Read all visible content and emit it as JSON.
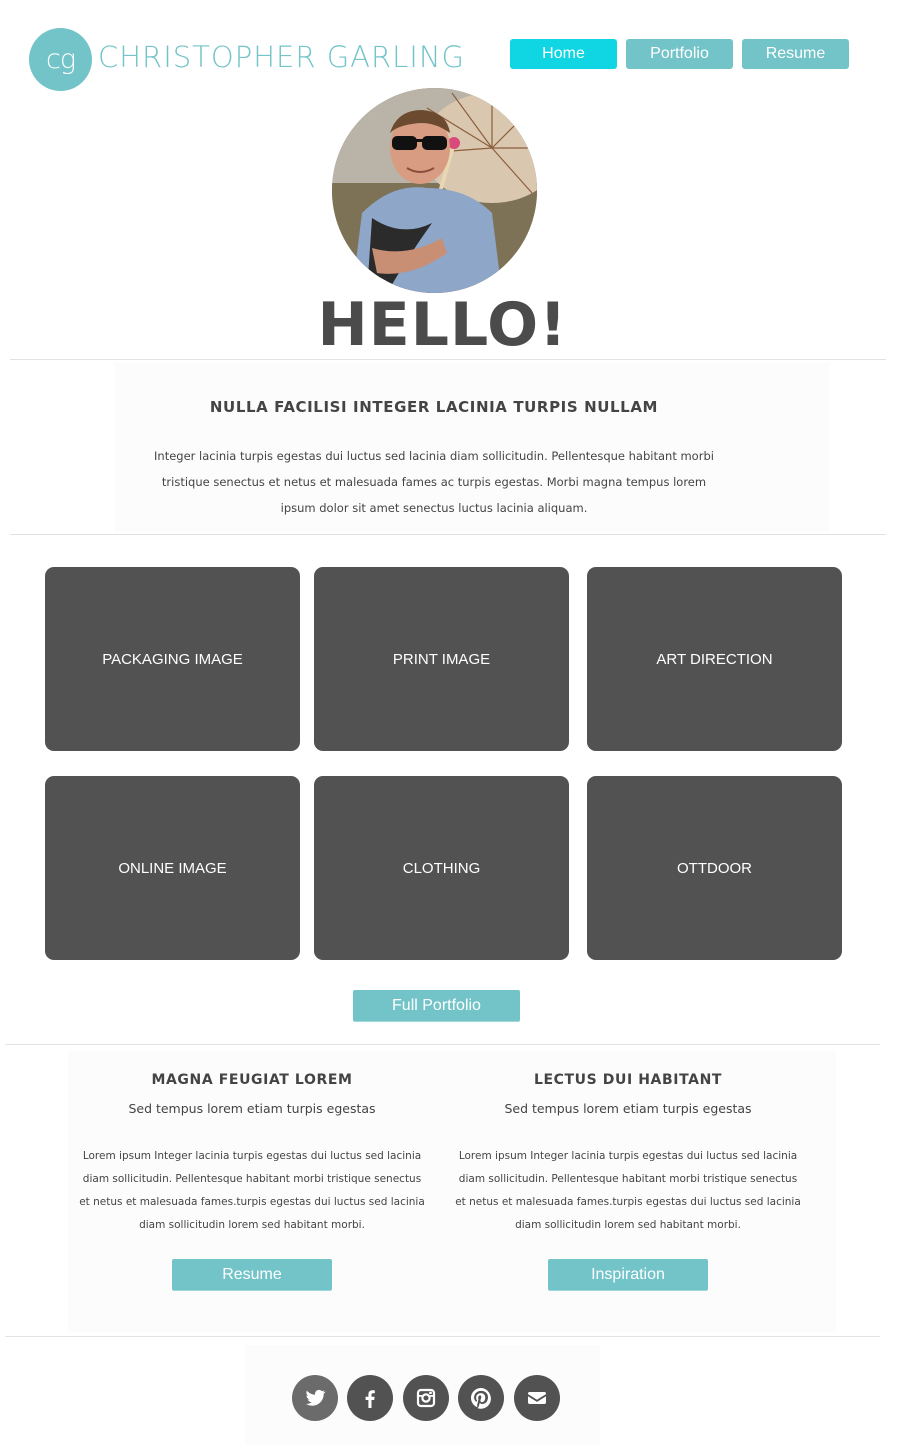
{
  "header": {
    "logo_initials": "cg",
    "site_name": "CHRISTOPHER GARLING",
    "nav": [
      {
        "label": "Home",
        "active": true
      },
      {
        "label": "Portfolio",
        "active": false
      },
      {
        "label": "Resume",
        "active": false
      }
    ]
  },
  "hero": {
    "greeting": "HELLO!"
  },
  "intro": {
    "title": "NULLA FACILISI INTEGER LACINIA TURPIS NULLAM",
    "text": "Integer lacinia turpis egestas dui luctus sed lacinia diam sollicitudin. Pellentesque habitant morbi tristique senectus et netus et malesuada fames ac turpis egestas. Morbi magna tempus lorem ipsum dolor sit amet senectus luctus lacinia aliquam."
  },
  "tiles": [
    "PACKAGING IMAGE",
    "PRINT IMAGE",
    "ART DIRECTION",
    "ONLINE IMAGE",
    "CLOTHING",
    "OTTDOOR"
  ],
  "portfolio_button": "Full Portfolio",
  "columns": [
    {
      "title": "MAGNA FEUGIAT LOREM",
      "subtitle": "Sed tempus lorem etiam turpis egestas",
      "text": "Lorem ipsum Integer lacinia turpis egestas dui luctus sed lacinia diam sollicitudin. Pellentesque habitant morbi tristique senectus et netus et malesuada fames.turpis egestas dui luctus sed lacinia diam sollicitudin lorem sed habitant morbi.",
      "button": "Resume"
    },
    {
      "title": "LECTUS DUI HABITANT",
      "subtitle": "Sed tempus lorem etiam turpis egestas",
      "text": "Lorem ipsum Integer lacinia turpis egestas dui luctus sed lacinia diam sollicitudin. Pellentesque habitant morbi tristique senectus et netus et malesuada fames.turpis egestas dui luctus sed lacinia diam sollicitudin lorem sed habitant morbi.",
      "button": "Inspiration"
    }
  ],
  "social": [
    "twitter-icon",
    "facebook-icon",
    "instagram-icon",
    "pinterest-icon",
    "email-icon"
  ],
  "colors": {
    "accent": "#73c4c9",
    "active_nav": "#0fd6e2",
    "tile": "#525252",
    "heading": "#4b4b4b"
  }
}
